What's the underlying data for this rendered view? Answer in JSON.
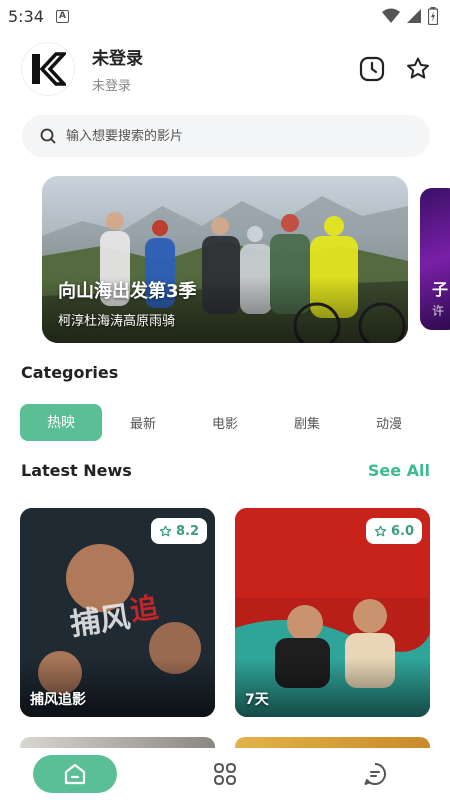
{
  "status_bar": {
    "time": "5:34",
    "notification_badge": "A",
    "icons": [
      "wifi-icon",
      "signal-icon",
      "battery-icon"
    ]
  },
  "header": {
    "logo_text": "K",
    "user_name": "未登录",
    "user_status": "未登录",
    "icons": [
      "history-clock-icon",
      "favorite-star-icon"
    ]
  },
  "search": {
    "placeholder": "输入想要搜索的影片",
    "icon": "search-icon"
  },
  "banner": {
    "items": [
      {
        "title": "向山海出发第3季",
        "subtitle": "柯淳杜海涛高原雨骑"
      },
      {
        "title": "子",
        "subtitle": "许"
      }
    ]
  },
  "categories": {
    "heading": "Categories",
    "tabs": [
      "热映",
      "最新",
      "电影",
      "剧集",
      "动漫"
    ],
    "active_index": 0
  },
  "latest_news": {
    "heading": "Latest News",
    "see_all": "See All",
    "cards": [
      {
        "title": "捕风追影",
        "rating": "8.2"
      },
      {
        "title": "7天",
        "rating": "6.0"
      }
    ]
  },
  "bottom_nav": {
    "items": [
      "home-icon",
      "apps-grid-icon",
      "chat-icon"
    ],
    "active_index": 0
  },
  "colors": {
    "accent": "#5bbf96",
    "accent_text": "#3dbb8e"
  }
}
